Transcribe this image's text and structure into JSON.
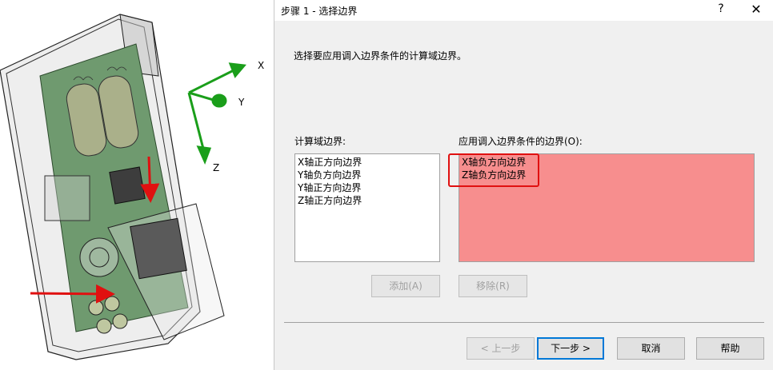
{
  "dialog": {
    "title": "步骤 1 - 选择边界",
    "help_glyph": "?",
    "close_glyph": "✕",
    "description": "选择要应用调入边界条件的计算域边界。",
    "left_list": {
      "label": "计算域边界:",
      "items": [
        "X轴正方向边界",
        "Y轴负方向边界",
        "Y轴正方向边界",
        "Z轴正方向边界"
      ]
    },
    "right_list": {
      "label": "应用调入边界条件的边界(O):",
      "items": [
        "X轴负方向边界",
        "Z轴负方向边界"
      ]
    },
    "buttons": {
      "add": "添加(A)",
      "remove": "移除(R)",
      "back": "< 上一步",
      "next": "下一步 >",
      "cancel": "取消",
      "help": "帮助"
    }
  },
  "viewport": {
    "axes": {
      "x": "X",
      "y": "Y",
      "z": "Z"
    }
  },
  "colors": {
    "highlight_fill": "#f78e8e",
    "annotation_red": "#e01010",
    "axis_green": "#1a9e1a",
    "pcb_green": "#6f9a6f"
  }
}
